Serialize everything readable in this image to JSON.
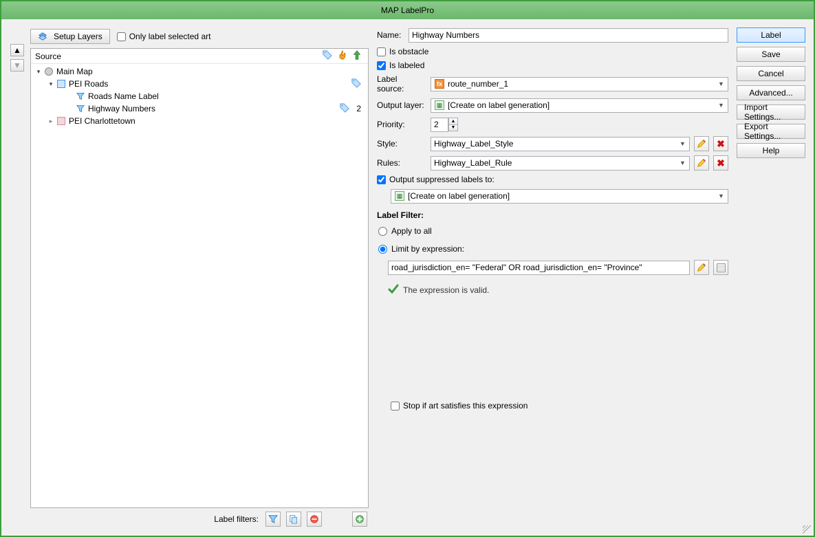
{
  "window": {
    "title": "MAP LabelPro"
  },
  "toolbar": {
    "setup_layers": "Setup Layers",
    "only_label_selected": "Only label selected art"
  },
  "tree": {
    "header": "Source",
    "nodes": {
      "root": "Main Map",
      "pei_roads": "PEI Roads",
      "roads_name_label": "Roads Name Label",
      "highway_numbers": "Highway Numbers",
      "highway_numbers_count": "2",
      "pei_charlottetown": "PEI Charlottetown"
    }
  },
  "footer": {
    "label_filters": "Label filters:"
  },
  "form": {
    "name_label": "Name:",
    "name_value": "Highway Numbers",
    "is_obstacle": "Is obstacle",
    "is_labeled": "Is labeled",
    "label_source_label": "Label source:",
    "label_source_value": "route_number_1",
    "output_layer_label": "Output layer:",
    "output_layer_value": "[Create on label generation]",
    "priority_label": "Priority:",
    "priority_value": "2",
    "style_label": "Style:",
    "style_value": "Highway_Label_Style",
    "rules_label": "Rules:",
    "rules_value": "Highway_Label_Rule",
    "output_suppressed": "Output suppressed labels to:",
    "output_suppressed_value": "[Create on label generation]",
    "label_filter_title": "Label Filter:",
    "apply_to_all": "Apply to all",
    "limit_by_expr": "Limit by expression:",
    "expression": "road_jurisdiction_en= \"Federal\" OR road_jurisdiction_en= \"Province\"",
    "expression_valid": "The expression is valid.",
    "stop_if": "Stop if art satisfies this expression"
  },
  "buttons": {
    "label": "Label",
    "save": "Save",
    "cancel": "Cancel",
    "advanced": "Advanced...",
    "import": "Import Settings...",
    "export": "Export Settings...",
    "help": "Help"
  }
}
